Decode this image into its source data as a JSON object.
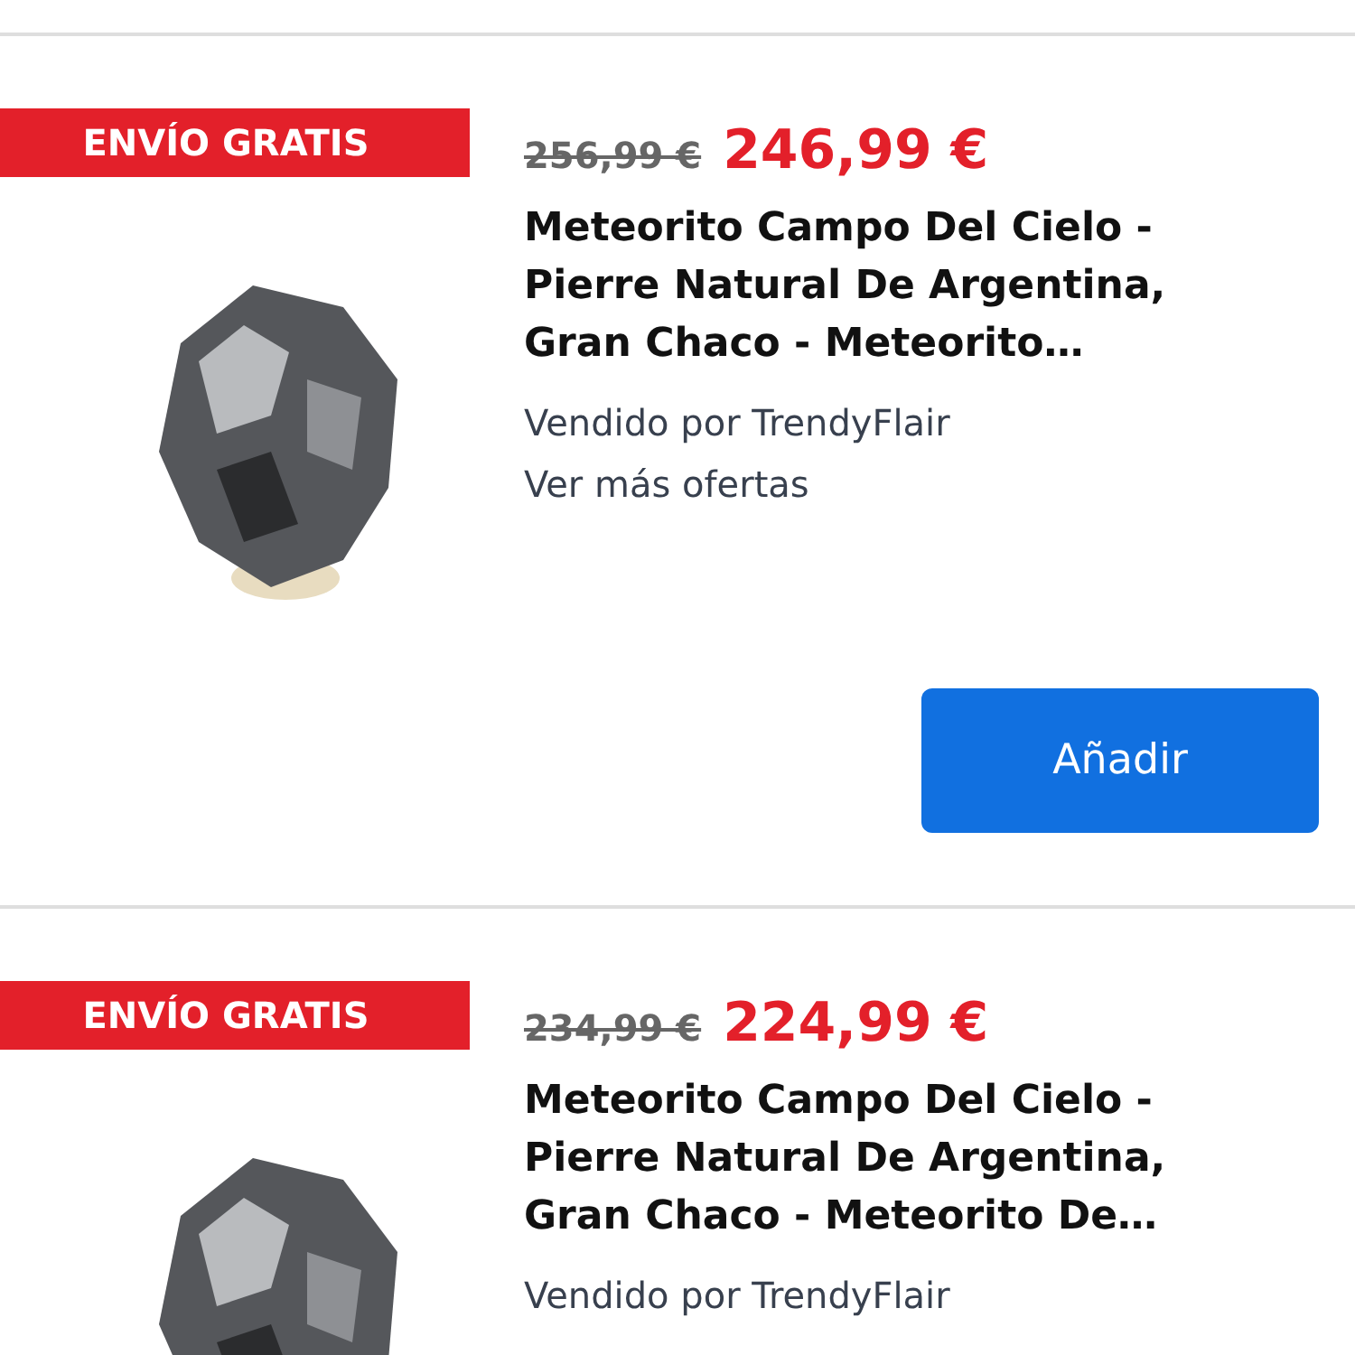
{
  "products": [
    {
      "badge": "ENVÍO GRATIS",
      "old_price": "256,99 €",
      "price": "246,99 €",
      "title": "Meteorito Campo Del Cielo - Pierre Natural De Argentina, Gran Chaco - Meteorito…",
      "seller": "Vendido por TrendyFlair",
      "more_offers": "Ver más ofertas",
      "button": "Añadir"
    },
    {
      "badge": "ENVÍO GRATIS",
      "old_price": "234,99 €",
      "price": "224,99 €",
      "title": "Meteorito Campo Del Cielo - Pierre Natural De Argentina, Gran Chaco - Meteorito De…",
      "seller": "Vendido por TrendyFlair"
    }
  ]
}
